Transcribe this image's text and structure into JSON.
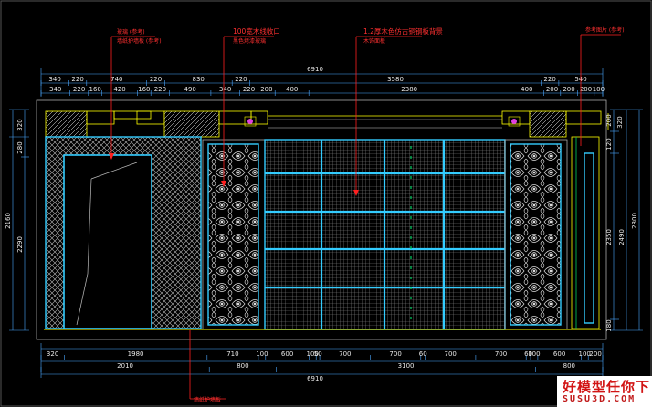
{
  "annotations": {
    "top1": "玻璃 (参考)",
    "top1_sub": "墙纸护墙板 (参考)",
    "top2": "100宽木线收口",
    "top2_sub": "黑色烤漆玻璃",
    "top3": "1.2厚木色仿古铜钢板背景",
    "top3_sub": "木饰面板",
    "top4": "参考图片 (参考)",
    "bottom1": "墙纸护墙板"
  },
  "dims_top": {
    "total": "6910",
    "r1": [
      "340",
      "220",
      "740",
      "220",
      "830",
      "220",
      "3580",
      "220",
      "540"
    ],
    "r2": [
      "340",
      "220",
      "160",
      "420",
      "160",
      "220",
      "490",
      "340",
      "220",
      "200",
      "400",
      "2380",
      "400",
      "200",
      "200",
      "200",
      "100"
    ]
  },
  "dims_bottom": {
    "r1": [
      "320",
      "1980",
      "710",
      "100",
      "600",
      "100",
      "50",
      "700",
      "700",
      "60",
      "700",
      "700",
      "60",
      "100",
      "600",
      "100",
      "200"
    ],
    "r2": [
      "2010",
      "800",
      "3100",
      "800"
    ],
    "total": "6910"
  },
  "dims_left": [
    "320",
    "280",
    "2160",
    "2290"
  ],
  "dims_right": [
    "320",
    "200",
    "120",
    "2350",
    "2490",
    "2800",
    "180"
  ],
  "watermark": {
    "line1": "好模型任你下",
    "line2": "SUSU3D.COM"
  },
  "colors": {
    "cad_bg": "#000000",
    "wall_outline": "#ffff00",
    "panel_cyan": "#33ccff",
    "annotation_red": "#ff3030",
    "dimension_text": "#e8e8e8"
  }
}
